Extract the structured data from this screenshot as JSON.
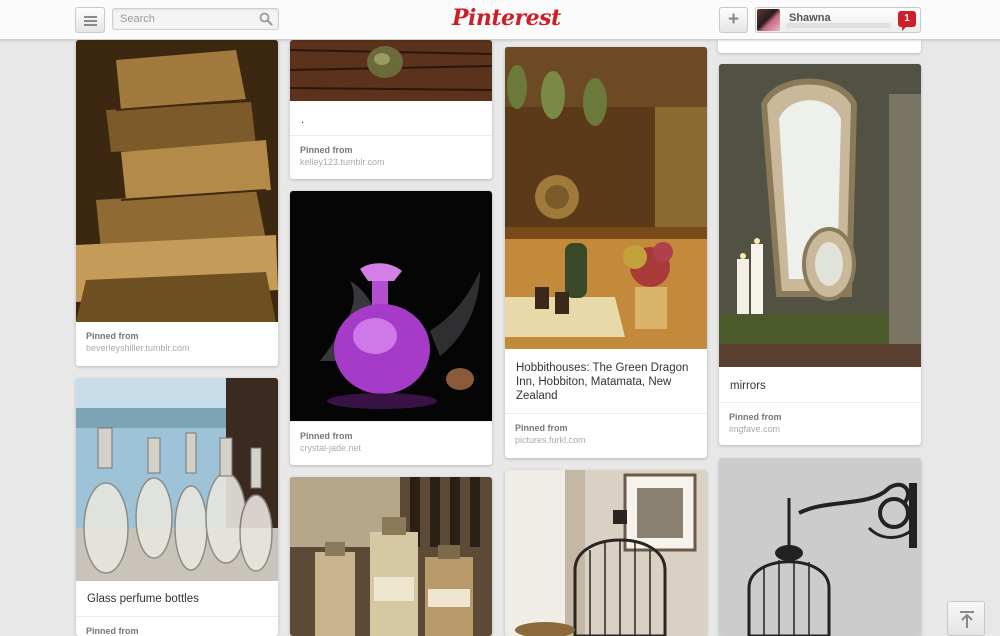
{
  "header": {
    "search_placeholder": "Search",
    "logo": "Pinterest",
    "add_label": "+",
    "username": "Shawna",
    "notification_count": "1"
  },
  "pins": [
    {
      "description": "",
      "pinned_label": "Pinned from",
      "source": "beverleyshiller.tumblr.com"
    },
    {
      "description": "Glass perfume bottles",
      "pinned_label": "Pinned from",
      "source": ""
    },
    {
      "description": ".",
      "pinned_label": "Pinned from",
      "source": "kelley123.tumblr.com"
    },
    {
      "description": "",
      "pinned_label": "Pinned from",
      "source": "crystal-jade.net"
    },
    {
      "description": "",
      "pinned_label": "",
      "source": ""
    },
    {
      "description": "Hobbithouses: The Green Dragon Inn, Hobbiton, Matamata, New Zealand",
      "pinned_label": "Pinned from",
      "source": "pictures.furkl.com"
    },
    {
      "description": "",
      "pinned_label": "",
      "source": ""
    },
    {
      "description": "mirrors",
      "pinned_label": "Pinned from",
      "source": "imgfave.com"
    },
    {
      "description": "",
      "pinned_label": "",
      "source": ""
    }
  ],
  "icons": {
    "menu": "menu-icon",
    "search": "search-icon",
    "notification": "notification-icon",
    "scroll_top": "scroll-to-top-icon"
  },
  "colors": {
    "brand": "#cb2027",
    "background": "#e9e8e8"
  }
}
